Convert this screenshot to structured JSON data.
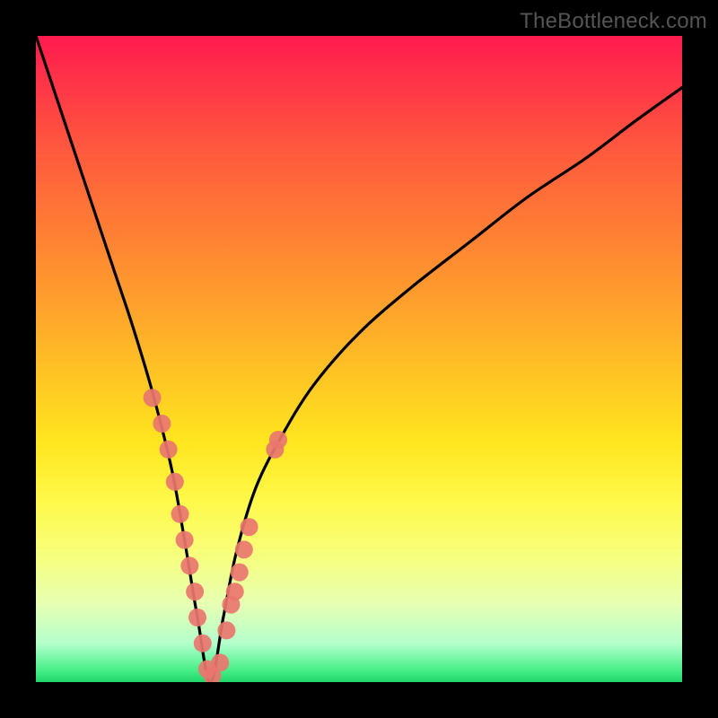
{
  "watermark": "TheBottleneck.com",
  "colors": {
    "background": "#000000",
    "curve": "#000000",
    "marker_fill": "#e9766f",
    "gradient_top": "#ff1a50",
    "gradient_bottom": "#1fd76a"
  },
  "chart_data": {
    "type": "line",
    "title": "",
    "xlabel": "",
    "ylabel": "",
    "xlim": [
      0,
      100
    ],
    "ylim": [
      0,
      100
    ],
    "note": "V-shaped bottleneck curve over rainbow gradient. x-axis is relative component scale; y-axis is bottleneck percentage (0 = balanced, 100 = severe). Valley near x≈27 reaches y≈0. Pink markers are sampled hardware data points clustered around the valley.",
    "series": [
      {
        "name": "bottleneck-curve",
        "x": [
          0,
          3,
          6,
          9,
          12,
          15,
          18,
          21,
          23,
          25,
          27,
          29,
          31,
          34,
          38,
          43,
          50,
          58,
          67,
          76,
          85,
          93,
          100
        ],
        "y": [
          100,
          91,
          82,
          73,
          64,
          55,
          45,
          33,
          22,
          10,
          0,
          10,
          20,
          30,
          38,
          46,
          54,
          61,
          68,
          75,
          81,
          87,
          92
        ]
      }
    ],
    "markers": {
      "name": "sample-points",
      "x": [
        18,
        19.5,
        20.5,
        21.5,
        22.3,
        23,
        23.8,
        24.6,
        25.0,
        25.8,
        26.5,
        27.3,
        28.5,
        29.5,
        30.2,
        30.8,
        31.5,
        32.2,
        33.0,
        37.0,
        37.5
      ],
      "y": [
        44,
        40,
        36,
        31,
        26,
        22,
        18,
        14,
        10,
        6,
        2,
        1,
        3,
        8,
        12,
        14,
        17,
        20.5,
        24,
        36,
        37.5
      ]
    }
  }
}
